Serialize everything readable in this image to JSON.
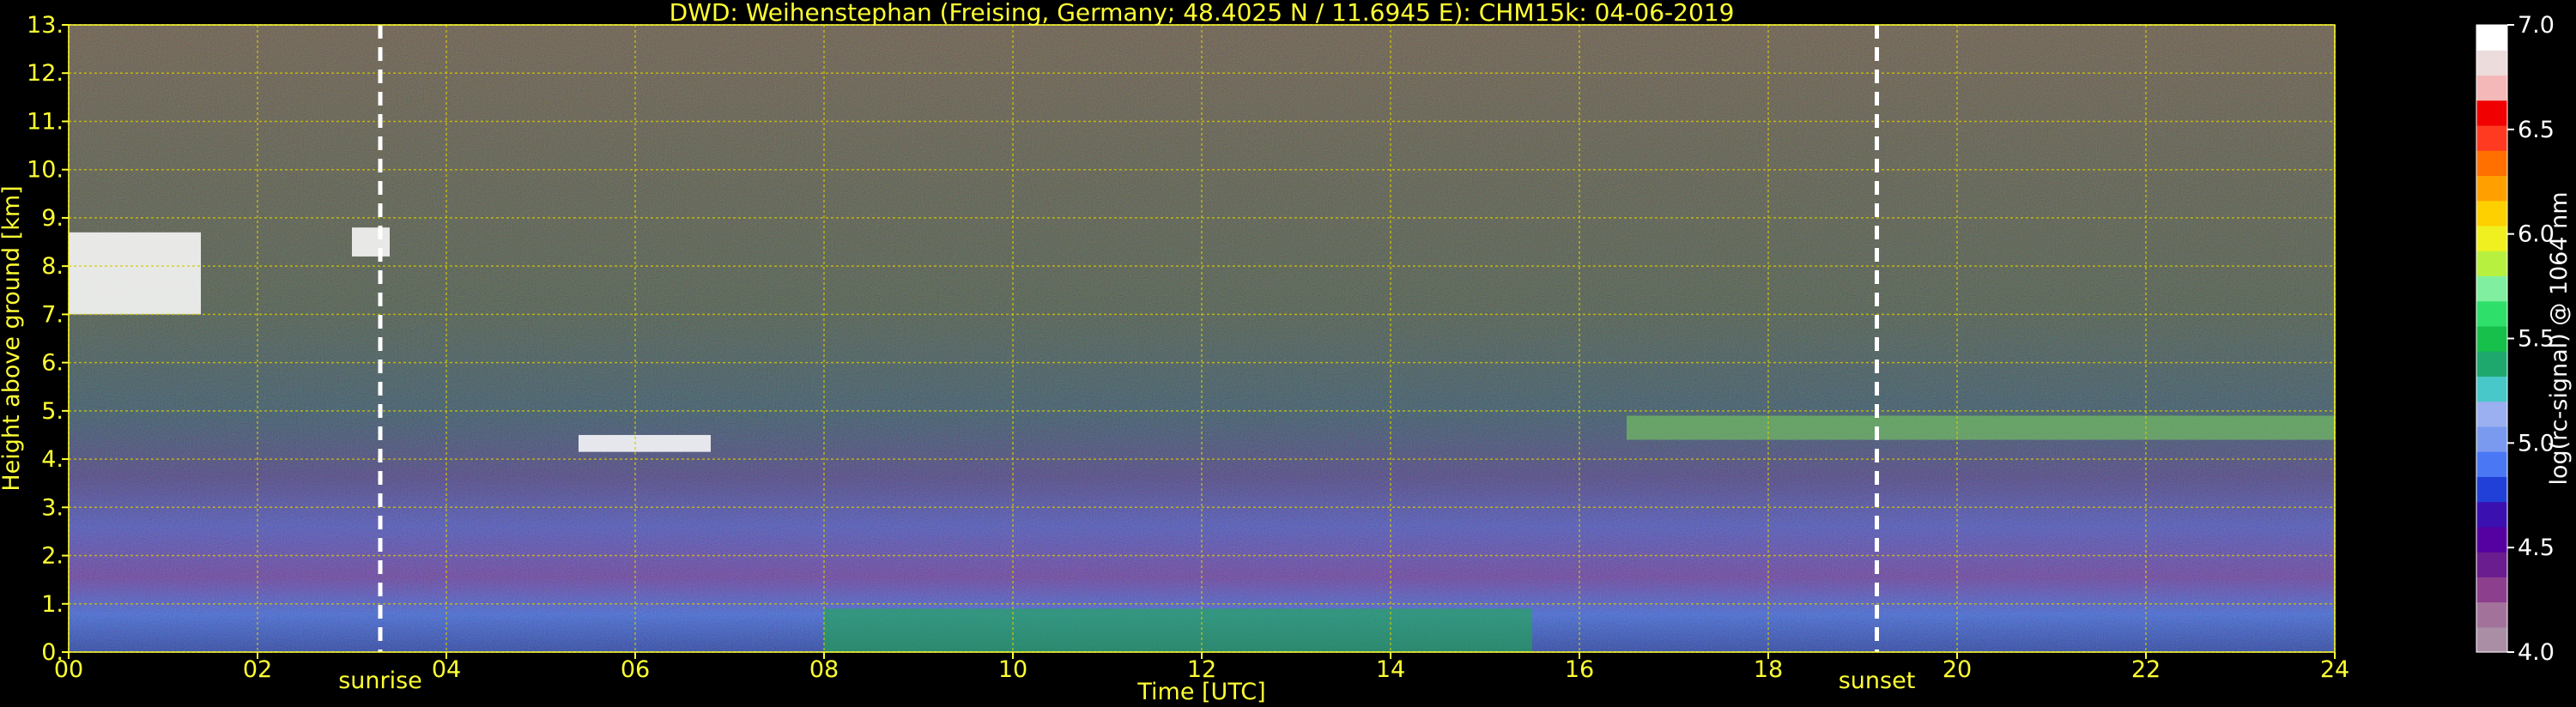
{
  "chart_data": {
    "type": "heatmap",
    "title": "DWD: Weihenstephan (Freising, Germany; 48.4025 N / 11.6945 E):    CHM15k: 04-06-2019",
    "xlabel": "Time [UTC]",
    "ylabel": "Height above ground [km]",
    "xlim": [
      0,
      24
    ],
    "ylim": [
      0,
      13
    ],
    "x_ticks": [
      "00",
      "02",
      "04",
      "06",
      "08",
      "10",
      "12",
      "14",
      "16",
      "18",
      "20",
      "22",
      "24"
    ],
    "y_ticks": [
      "0.",
      "1.",
      "2.",
      "3.",
      "4.",
      "5.",
      "6.",
      "7.",
      "8.",
      "9.",
      "10.",
      "11.",
      "12.",
      "13."
    ],
    "grid": true,
    "annotations": [
      {
        "label": "sunrise",
        "x": 3.3
      },
      {
        "label": "sunset",
        "x": 19.15
      }
    ],
    "colorbar": {
      "label": "log(rc-signal) @ 1064 nm",
      "range": [
        4.0,
        7.0
      ],
      "ticks": [
        "4.0",
        "4.5",
        "5.0",
        "5.5",
        "6.0",
        "6.5",
        "7.0"
      ],
      "colors": [
        "#a98ea5",
        "#a3729b",
        "#8c3f8c",
        "#6a1d8e",
        "#5500a0",
        "#3a10b0",
        "#2040d8",
        "#4a78f5",
        "#7a9af0",
        "#9bb0f0",
        "#48c8c8",
        "#1ea86e",
        "#17c04b",
        "#2ee06a",
        "#80f0a0",
        "#b8f040",
        "#f0f020",
        "#ffd000",
        "#ffa000",
        "#ff7000",
        "#ff3a20",
        "#f00000",
        "#f5b8b8",
        "#ecdcdc",
        "#ffffff"
      ]
    },
    "features": [
      {
        "name": "cloud",
        "x": [
          0.0,
          1.4
        ],
        "y": [
          7.0,
          8.7
        ]
      },
      {
        "name": "cloud",
        "x": [
          3.0,
          3.4
        ],
        "y": [
          8.2,
          8.8
        ]
      },
      {
        "name": "cloud",
        "x": [
          5.4,
          6.8
        ],
        "y": [
          4.15,
          4.5
        ]
      },
      {
        "name": "aerosol-layer",
        "x": [
          8.0,
          15.5
        ],
        "y": [
          0.0,
          0.9
        ]
      },
      {
        "name": "elevated-layer",
        "x": [
          16.5,
          24.0
        ],
        "y": [
          4.4,
          4.9
        ]
      }
    ]
  }
}
